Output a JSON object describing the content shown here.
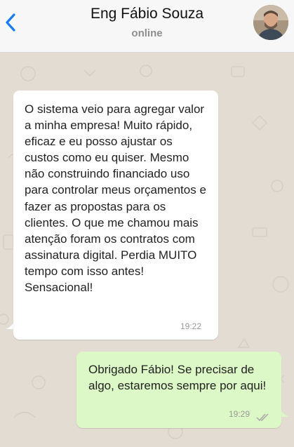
{
  "header": {
    "contact_name": "Eng Fábio Souza",
    "status": "online",
    "back_icon": "chevron-left-icon",
    "accent_color": "#1a7cf5"
  },
  "messages": [
    {
      "direction": "incoming",
      "text": "O sistema veio para agregar valor a minha empresa! Muito rápido, eficaz e eu posso ajustar os custos como eu quiser. Mesmo não construindo financiado uso para controlar meus orçamentos e fazer as propostas para os clientes. O que me chamou mais atenção foram os contratos com assinatura digital. Perdia MUITO tempo com isso antes! Sensacional!",
      "time": "19:22",
      "bubble_color": "#ffffff"
    },
    {
      "direction": "outgoing",
      "text": "Obrigado Fábio! Se precisar de algo, estaremos sempre por aqui!",
      "time": "19:29",
      "status_icon": "double-check-icon",
      "bubble_color": "#dcf8c6"
    }
  ],
  "colors": {
    "wallpaper": "#e5ddd5",
    "header_bg": "#f7f7f7"
  }
}
